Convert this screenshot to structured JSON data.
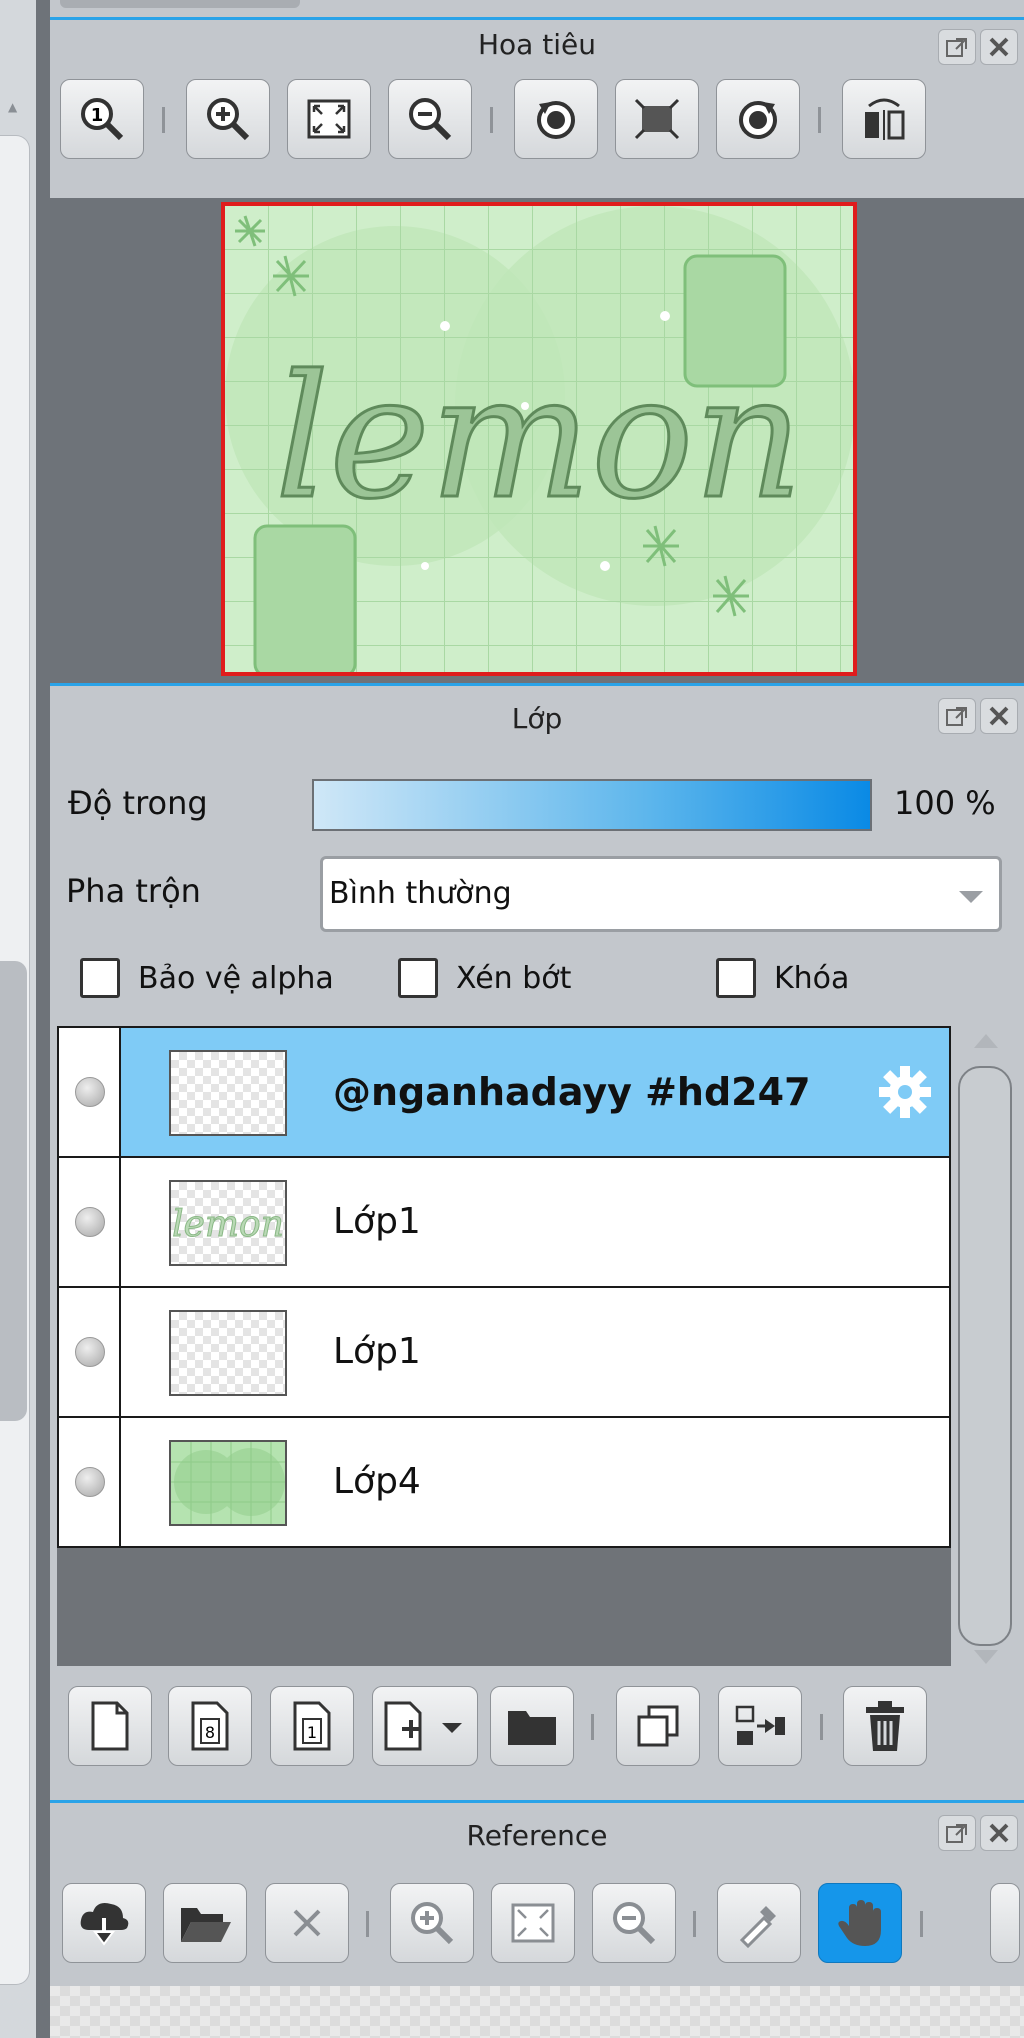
{
  "navigator": {
    "title": "Hoa tiêu",
    "canvas_text": "lemon"
  },
  "layers": {
    "title": "Lớp",
    "opacity_label": "Độ trong",
    "opacity_value": "100 %",
    "opacity_fraction": 1.0,
    "blend_label": "Pha trộn",
    "blend_value": "Bình thường",
    "checkboxes": {
      "protect_alpha": "Bảo vệ alpha",
      "clipping": "Xén bớt",
      "lock": "Khóa"
    },
    "items": [
      {
        "name": "@nganhadayy #hd247",
        "selected": true
      },
      {
        "name": "Lớp1",
        "selected": false
      },
      {
        "name": "Lớp1",
        "selected": false
      },
      {
        "name": "Lớp4",
        "selected": false
      }
    ]
  },
  "reference": {
    "title": "Reference"
  },
  "colors": {
    "accent": "#2aa3e8",
    "selected_row": "#7fcbf6",
    "active_tool": "#1596ea",
    "canvas_border": "#e01c1c",
    "canvas_bg": "#cfeeca"
  }
}
